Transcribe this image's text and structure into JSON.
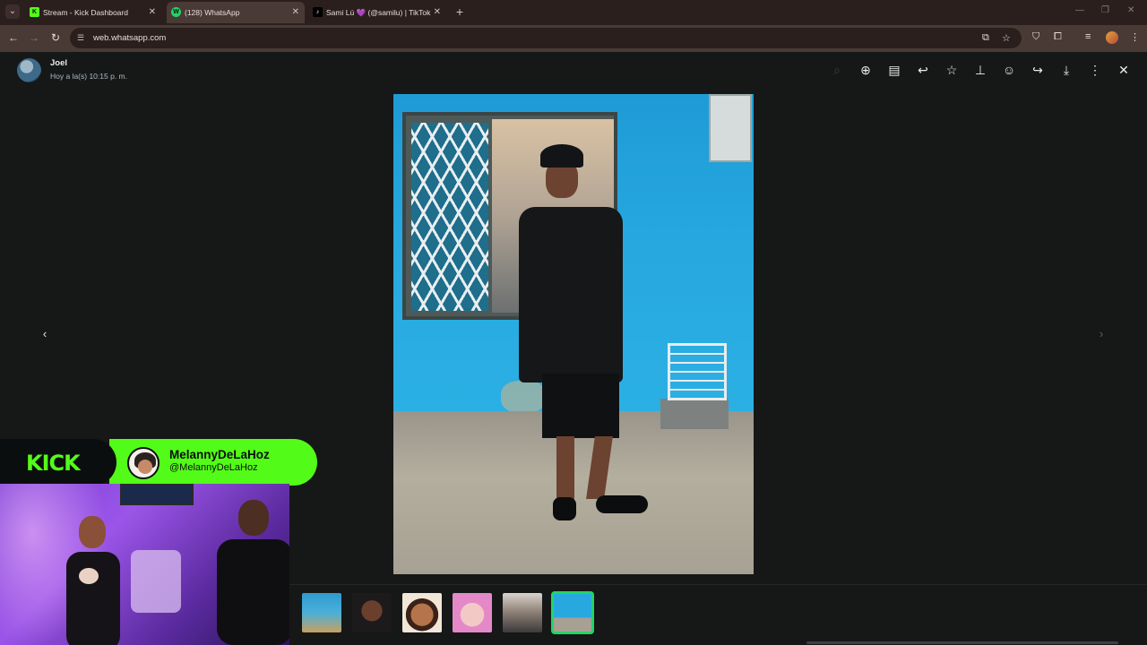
{
  "browser": {
    "tabs": [
      {
        "title": "Stream - Kick Dashboard",
        "favicon": "kick-icon",
        "active": false
      },
      {
        "title": "(128) WhatsApp",
        "favicon": "whatsapp-icon",
        "active": true
      },
      {
        "title": "Sami Lú 💜 (@samilu) | TikTok",
        "favicon": "tiktok-icon",
        "active": false
      }
    ],
    "url": "web.whatsapp.com"
  },
  "viewer": {
    "contact_name": "Joel",
    "timestamp": "Hoy a la(s) 10:15 p. m.",
    "toolbar_icons": [
      "zoom-in-icon",
      "view-in-chat-icon",
      "reply-icon",
      "star-icon",
      "pin-icon",
      "react-emoji-icon",
      "forward-icon",
      "download-icon",
      "menu-icon",
      "close-icon"
    ],
    "thumbnail_count": 6,
    "selected_thumbnail": 6
  },
  "overlay": {
    "brand": "KICK",
    "streamer_name": "MelannyDeLaHoz",
    "streamer_handle": "@MelannyDeLaHoz"
  },
  "colors": {
    "tab_bar": "#2a1f1d",
    "kick_green": "#53fc18",
    "whatsapp_green": "#25d366",
    "viewer_bg": "#161717"
  }
}
